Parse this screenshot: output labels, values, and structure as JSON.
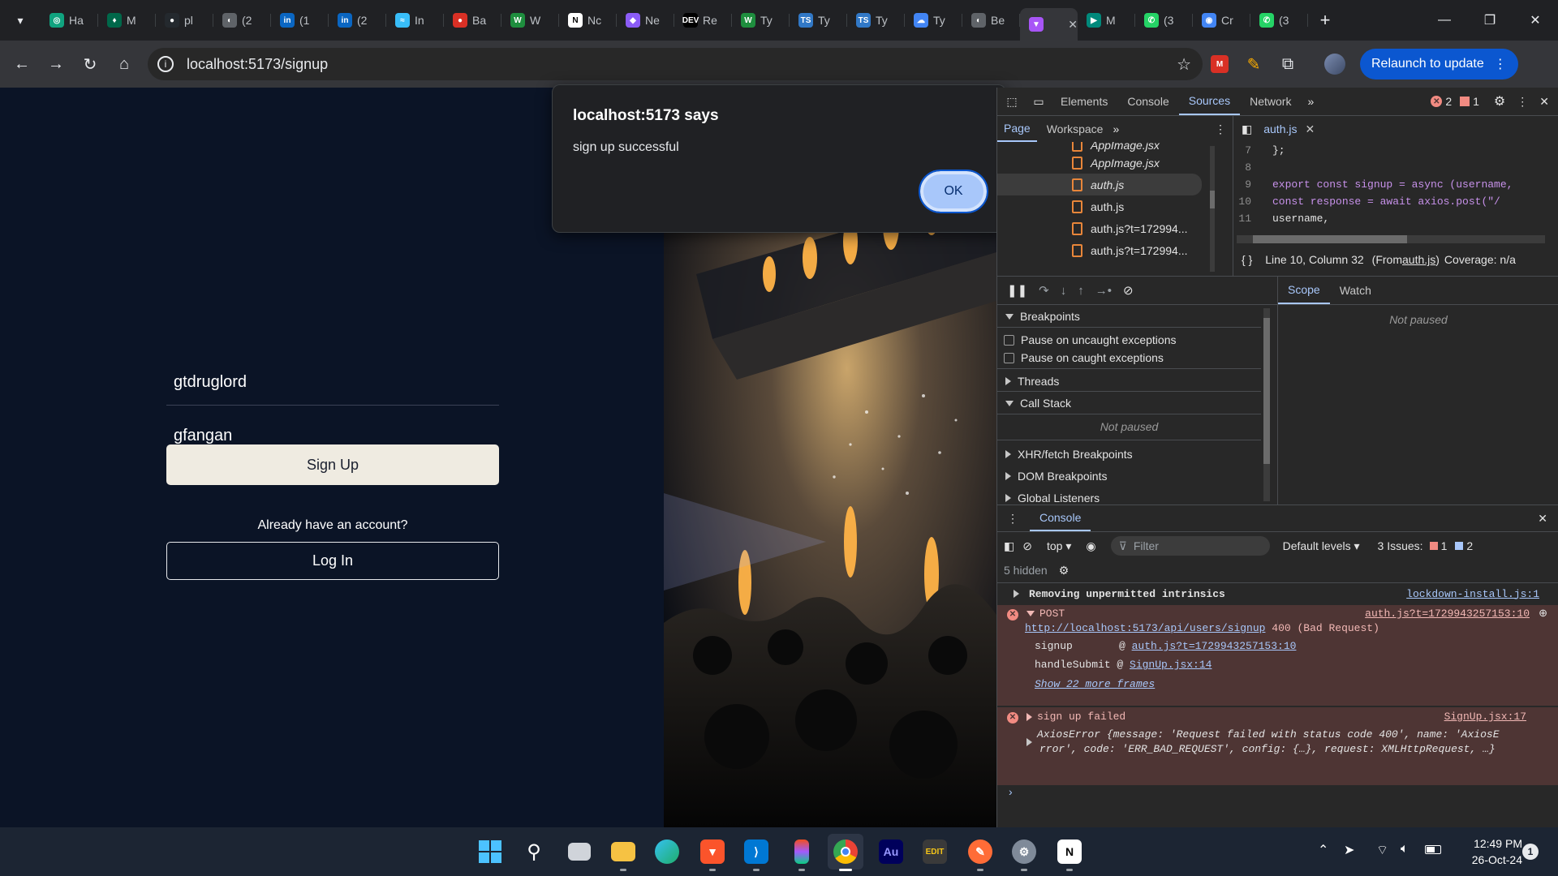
{
  "browser": {
    "tabs": [
      {
        "title": "Ha",
        "icon": "chatgpt-icon",
        "color": "#10a37f"
      },
      {
        "title": "M",
        "icon": "mongodb-icon",
        "color": "#00684a"
      },
      {
        "title": "pl",
        "icon": "github-icon",
        "color": "#24292e"
      },
      {
        "title": "(2",
        "icon": "globe-icon",
        "color": "#5f6368"
      },
      {
        "title": "(1",
        "icon": "linkedin-icon",
        "color": "#0a66c2"
      },
      {
        "title": "(2",
        "icon": "linkedin-icon",
        "color": "#0a66c2"
      },
      {
        "title": "In",
        "icon": "tailwind-icon",
        "color": "#38bdf8"
      },
      {
        "title": "Ba",
        "icon": "record-icon",
        "color": "#d93025"
      },
      {
        "title": "W",
        "icon": "webflow-icon",
        "color": "#1e8e3e"
      },
      {
        "title": "Nc",
        "icon": "notion-icon",
        "color": "#ffffff"
      },
      {
        "title": "Ne",
        "icon": "nexus-icon",
        "color": "#8b5cf6"
      },
      {
        "title": "Re",
        "icon": "dev-icon",
        "color": "#000000"
      },
      {
        "title": "Ty",
        "icon": "w-icon",
        "color": "#1e8e3e"
      },
      {
        "title": "Ty",
        "icon": "ts-icon",
        "color": "#3178c6"
      },
      {
        "title": "Ty",
        "icon": "ts-icon",
        "color": "#3178c6"
      },
      {
        "title": "Ty",
        "icon": "cloud-icon",
        "color": "#4285f4"
      },
      {
        "title": "Be",
        "icon": "globe-icon",
        "color": "#5f6368"
      },
      {
        "title": "",
        "icon": "vite-icon",
        "color": "#a855f7",
        "active": true
      },
      {
        "title": "M",
        "icon": "meet-icon",
        "color": "#00897b"
      },
      {
        "title": "(3",
        "icon": "whatsapp-icon",
        "color": "#25d366"
      },
      {
        "title": "Cr",
        "icon": "chrome-icon",
        "color": "#4285f4"
      },
      {
        "title": "(3",
        "icon": "whatsapp-icon",
        "color": "#25d366"
      }
    ],
    "url": "localhost:5173/signup",
    "relaunch_label": "Relaunch to update"
  },
  "page": {
    "username_value": "gtdruglord",
    "password_value": "gfangan",
    "signup_label": "Sign Up",
    "have_account_text": "Already have an account?",
    "login_label": "Log In"
  },
  "dialog": {
    "title": "localhost:5173 says",
    "message": "sign up successful",
    "ok_label": "OK"
  },
  "devtools": {
    "tabs": [
      "Elements",
      "Console",
      "Sources",
      "Network"
    ],
    "active_tab": "Sources",
    "error_count": "2",
    "warn_count": "1",
    "nav_tabs": [
      "Page",
      "Workspace"
    ],
    "files": [
      "AppImage.jsx",
      "AppImage.jsx",
      "auth.js",
      "auth.js",
      "auth.js?t=172994...",
      "auth.js?t=172994..."
    ],
    "open_file": "auth.js",
    "code_lines": [
      {
        "n": "7",
        "text": "};"
      },
      {
        "n": "8",
        "text": ""
      },
      {
        "n": "9",
        "text": "export const signup = async (username,"
      },
      {
        "n": "10",
        "text": "const response = await axios.post(\"/"
      },
      {
        "n": "11",
        "text": "username,"
      }
    ],
    "status_line": "Line 10, Column 32",
    "status_from": "(From ",
    "status_file": "auth.js",
    "status_close": ")",
    "coverage": "Coverage: n/a",
    "debugger": {
      "breakpoints": "Breakpoints",
      "pause_uncaught": "Pause on uncaught exceptions",
      "pause_caught": "Pause on caught exceptions",
      "threads": "Threads",
      "call_stack": "Call Stack",
      "not_paused": "Not paused",
      "xhr": "XHR/fetch Breakpoints",
      "dom": "DOM Breakpoints",
      "global": "Global Listeners",
      "scope": "Scope",
      "watch": "Watch"
    },
    "console": {
      "title": "Console",
      "context": "top",
      "filter_placeholder": "Filter",
      "levels": "Default levels",
      "issues_label": "3 Issues:",
      "issues_err": "1",
      "issues_info": "2",
      "hidden": "5 hidden",
      "msg1": "Removing unpermitted intrinsics",
      "msg1_src": "lockdown-install.js:1",
      "post_label": "POST",
      "post_src": "auth.js?t=1729943257153:10",
      "post_url": "http://localhost:5173/api/users/signup",
      "post_status": "400 (Bad Request)",
      "frame1_fn": "signup",
      "frame1_src": "auth.js?t=1729943257153:10",
      "frame2_fn": "handleSubmit",
      "frame2_src": "SignUp.jsx:14",
      "more_frames": "Show 22 more frames",
      "err2": "sign up failed",
      "err2_src": "SignUp.jsx:17",
      "axios_line1": "AxiosError {message: 'Request failed with status code 400', name: 'AxiosE",
      "axios_line2": "rror', code: 'ERR_BAD_REQUEST', config: {…}, request: XMLHttpRequest, …}"
    }
  },
  "taskbar": {
    "time": "12:49 PM",
    "date": "26-Oct-24",
    "notification_count": "1"
  }
}
